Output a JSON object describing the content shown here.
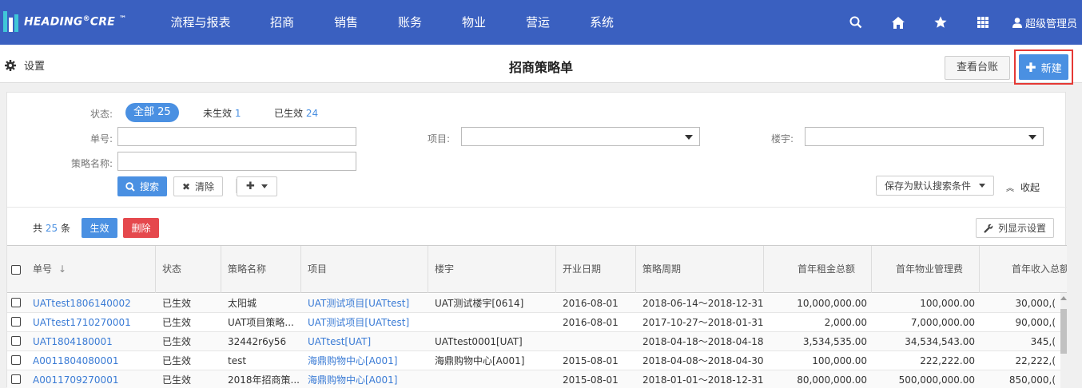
{
  "brand": {
    "name": "HEADING",
    "reg": "®",
    "suffix": "CRE",
    "tm": "™"
  },
  "nav": {
    "items": [
      "流程与报表",
      "招商",
      "销售",
      "账务",
      "物业",
      "营运",
      "系统"
    ]
  },
  "user": {
    "name": "超级管理员"
  },
  "subheader": {
    "settings": "设置",
    "title": "招商策略单",
    "ledger": "查看台账",
    "new": "新建"
  },
  "filters": {
    "status_label": "状态:",
    "all": "全部 25",
    "inactive_label": "未生效",
    "inactive_count": "1",
    "active_label": "已生效",
    "active_count": "24",
    "code_label": "单号:",
    "project_label": "项目:",
    "building_label": "楼宇:",
    "name_label": "策略名称:",
    "search": "搜索",
    "clear": "清除",
    "save_default": "保存为默认搜索条件",
    "collapse": "收起"
  },
  "list": {
    "count_prefix": "共",
    "count": "25",
    "count_suffix": "条",
    "activate": "生效",
    "delete": "删除",
    "columns_setting": "列显示设置"
  },
  "table": {
    "headers": [
      "单号",
      "状态",
      "策略名称",
      "项目",
      "楼宇",
      "开业日期",
      "策略周期",
      "首年租金总额",
      "首年物业管理费",
      "首年收入总额"
    ],
    "rows": [
      [
        "UATtest1806140002",
        "已生效",
        "太阳城",
        "UAT测试项目[UATtest]",
        "UAT测试楼宇[0614]",
        "2016-08-01",
        "2018-06-14～2018-12-31",
        "10,000,000.00",
        "100,000.00",
        "30,000,("
      ],
      [
        "UATtest1710270001",
        "已生效",
        "UAT项目策略...",
        "UAT测试项目[UATtest]",
        "",
        "2016-08-01",
        "2017-10-27～2018-01-31",
        "2,000.00",
        "7,000,000.00",
        "90,000,("
      ],
      [
        "UAT1804180001",
        "已生效",
        "32442r6y56",
        "UATtest[UAT]",
        "UATtest0001[UAT]",
        "",
        "2018-04-18～2018-04-18",
        "3,534,535.00",
        "34,534,543.00",
        "345,("
      ],
      [
        "A0011804080001",
        "已生效",
        "test",
        "海鼎购物中心[A001]",
        "海鼎购物中心[A001]",
        "2015-08-01",
        "2018-04-08～2018-04-30",
        "100,000.00",
        "222,222.00",
        "22,222,("
      ],
      [
        "A0011709270001",
        "已生效",
        "2018年招商策...",
        "海鼎购物中心[A001]",
        "",
        "2015-08-01",
        "2018-01-01～2018-12-31",
        "80,000,000.00",
        "500,000,000.00",
        "850,000,("
      ]
    ]
  }
}
